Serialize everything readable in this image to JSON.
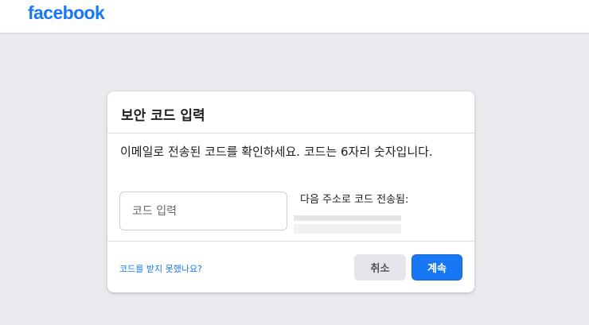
{
  "header": {
    "logo_text": "facebook",
    "brand_color": "#1877f2"
  },
  "dialog": {
    "title": "보안 코드 입력",
    "instructions": "이메일로 전송된 코드를 확인하세요. 코드는 6자리 숫자입니다.",
    "code_input": {
      "value": "",
      "placeholder": "코드 입력"
    },
    "sent_to_label": "다음 주소로 코드 전송됨:",
    "no_code_link": "코드를 받지 못했나요?",
    "cancel_label": "취소",
    "continue_label": "계속"
  }
}
